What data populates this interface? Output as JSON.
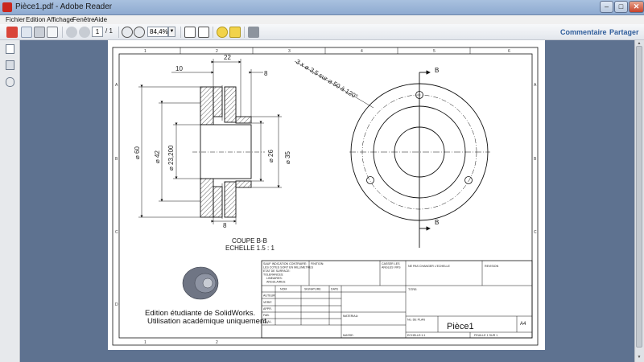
{
  "window": {
    "title": "Pièce1.pdf - Adobe Reader",
    "min_symbol": "–",
    "max_symbol": "□",
    "close_symbol": "✕"
  },
  "menu": [
    "Fichier",
    "Edition",
    "Affichage",
    "Fenêtre",
    "Aide"
  ],
  "toolbar": {
    "page_current": "1",
    "page_total": "/ 1",
    "zoom": "84,4%",
    "commentaire": "Commentaire",
    "partager": "Partager"
  },
  "drawing": {
    "dims": {
      "d22": "22",
      "d10": "10",
      "d8_top": "8",
      "d8_bottom": "8",
      "d60": "⌀ 60",
      "d42": "⌀ 42",
      "d23": "⌀ 23,200",
      "d26": "⌀ 26",
      "d35": "⌀ 35",
      "holes": "3 x ⌀ 3,5 sur ⌀ 50 à 120°"
    },
    "section_marker": "B",
    "section_title": "COUPE B-B",
    "section_scale": "ECHELLE 1.5 : 1",
    "border_cols": [
      "1",
      "2",
      "3",
      "4",
      "5",
      "6"
    ],
    "border_rows": [
      "A",
      "B",
      "C",
      "D"
    ],
    "watermark": [
      "Edition étudiante de SolidWorks.",
      "Utilisation académique uniquement."
    ],
    "titleblock": {
      "tolerances": [
        "SAUF INDICATION CONTRAIRE:",
        "LES COTES SONT EN MILLIMETRES",
        "ETAT DE SURFACE:",
        "TOLERANCES:",
        "LINEAIRES:",
        "ANGULAIRES:"
      ],
      "finition": "FINITION:",
      "casser": [
        "CASSER LES",
        "ANGLES VIFS"
      ],
      "ne_pas_changer": "NE PAS CHANGER L'ECHELLE",
      "revision": "REVISION",
      "nom": "NOM",
      "signature": "SIGNATURE",
      "date": "DATE",
      "roles": [
        "AUTEUR",
        "VERIF.",
        "APPR.",
        "FAB.",
        "QUAL."
      ],
      "titre": "TITRE:",
      "materiau": "MATERIAU:",
      "masse": "MASSE:",
      "no_plan": "No. DE PLAN",
      "part_name": "Pièce1",
      "format": "A4",
      "echelle": "ECHELLE:1:1",
      "feuille": "FEUILLE 1 SUR 1"
    }
  }
}
